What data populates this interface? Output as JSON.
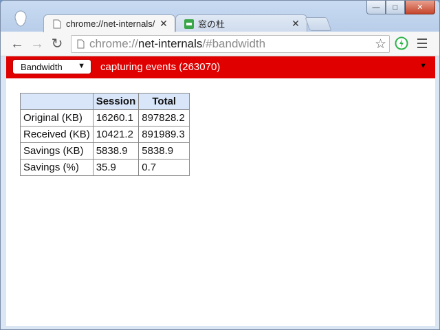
{
  "tabs": [
    {
      "title": "chrome://net-internals/",
      "active": true,
      "favicon": "document-icon"
    },
    {
      "title": "窓の杜",
      "active": false,
      "favicon": "site-favicon-green"
    }
  ],
  "window_controls": {
    "minimize": "—",
    "maximize": "□",
    "close": "✕"
  },
  "toolbar": {
    "back": "←",
    "forward": "→",
    "reload": "↻",
    "url_scheme": "chrome://",
    "url_host": "net-internals",
    "url_path": "/#bandwidth",
    "star": "☆"
  },
  "tab_close_glyph": "✕",
  "net_internals": {
    "view_select": "Bandwidth",
    "status": "capturing events (263070)",
    "caret": "▼"
  },
  "bandwidth_table": {
    "headers": [
      "",
      "Session",
      "Total"
    ],
    "rows": [
      [
        "Original (KB)",
        "16260.1",
        "897828.2"
      ],
      [
        "Received (KB)",
        "10421.2",
        "891989.3"
      ],
      [
        "Savings (KB)",
        "5838.9",
        "5838.9"
      ],
      [
        "Savings (%)",
        "35.9",
        "0.7"
      ]
    ]
  },
  "colors": {
    "status_bar": "#e00000",
    "header_cell": "#d9e6f9",
    "extension_icon": "#2db34a"
  }
}
